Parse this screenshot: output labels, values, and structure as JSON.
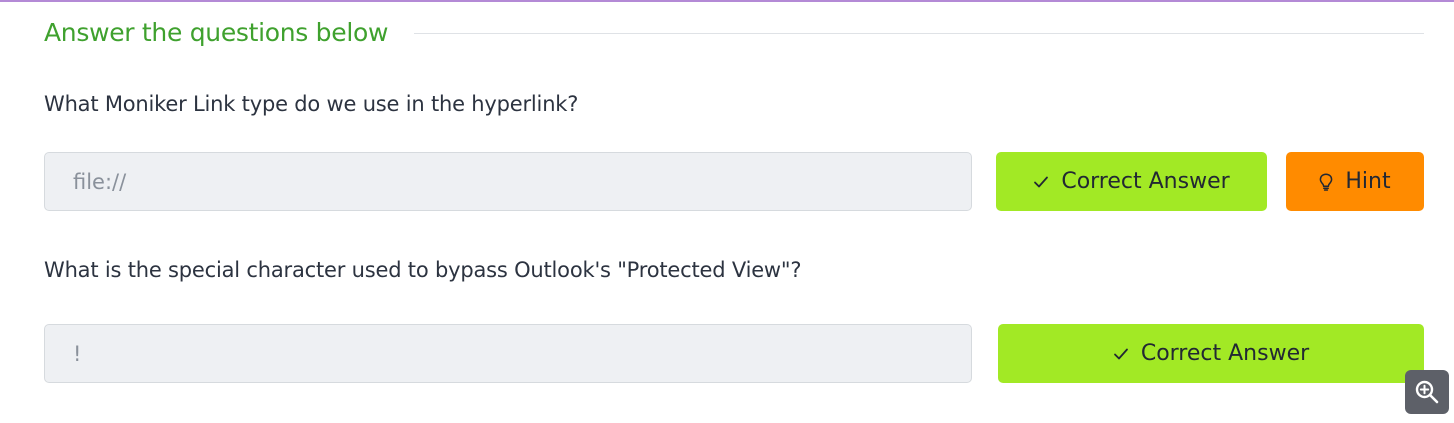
{
  "section": {
    "title": "Answer the questions below"
  },
  "questions": [
    {
      "text": "What Moniker Link type do we use in the hyperlink?",
      "answer_value": "file://",
      "correct_label": "Correct Answer",
      "hint_label": "Hint"
    },
    {
      "text": "What is the special character used to bypass Outlook's \"Protected View\"?",
      "answer_value": "!",
      "correct_label": "Correct Answer"
    }
  ],
  "icons": {
    "correct": "check-icon",
    "hint": "lightbulb-icon",
    "zoom": "zoom-in-icon"
  },
  "colors": {
    "section_title": "#3fa12e",
    "correct_button": "#a2e925",
    "hint_button": "#ff8b00",
    "input_background": "#eef0f3",
    "top_border": "#b48ad6"
  }
}
